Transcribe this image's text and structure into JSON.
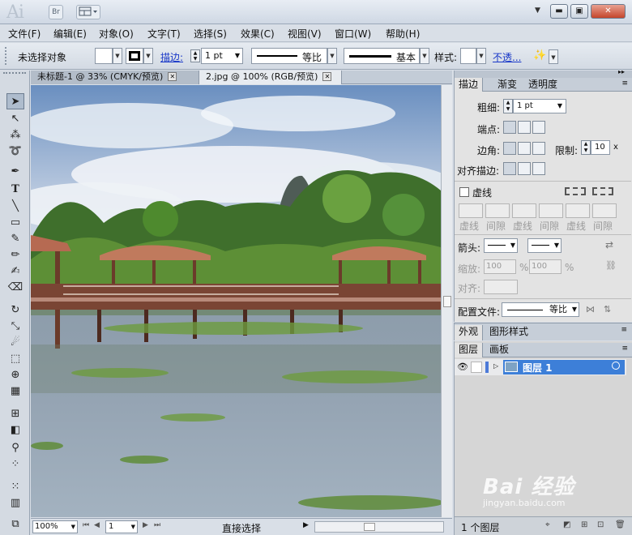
{
  "app": {
    "logo": "Ai",
    "bridge_label": "Br"
  },
  "menu": [
    "文件(F)",
    "编辑(E)",
    "对象(O)",
    "文字(T)",
    "选择(S)",
    "效果(C)",
    "视图(V)",
    "窗口(W)",
    "帮助(H)"
  ],
  "control": {
    "selection_status": "未选择对象",
    "stroke_label": "描边:",
    "stroke_weight": "1 pt",
    "stroke_profile": "等比",
    "brush": "基本",
    "style_label": "样式:",
    "opacity_label": "不透..."
  },
  "documents": [
    {
      "title": "未标题-1 @ 33% (CMYK/预览)",
      "close": "⊠"
    },
    {
      "title": "2.jpg @ 100% (RGB/预览)",
      "close": "⊠"
    }
  ],
  "status": {
    "zoom": "100%",
    "page": "1",
    "tool": "直接选择"
  },
  "stroke_panel": {
    "tabs": [
      "描边",
      "渐变",
      "透明度"
    ],
    "weight_label": "粗细:",
    "weight_value": "1 pt",
    "cap_label": "端点:",
    "corner_label": "边角:",
    "limit_label": "限制:",
    "limit_value": "10",
    "limit_unit": "x",
    "align_label": "对齐描边:",
    "dashed_label": "虚线",
    "dash_labels": [
      "虚线",
      "间隙",
      "虚线",
      "间隙",
      "虚线",
      "间隙"
    ],
    "arrow_label": "箭头:",
    "scale_label": "缩放:",
    "scale_start": "100",
    "scale_end": "100",
    "percent": "%",
    "align_arrow_label": "对齐:",
    "profile_label": "配置文件:",
    "profile_value": "等比"
  },
  "appearance_tabs": [
    "外观",
    "图形样式"
  ],
  "layers_panel": {
    "tabs": [
      "图层",
      "画板"
    ],
    "layer_name": "图层 1",
    "count": "1 个图层"
  },
  "watermark": {
    "text": "Bai 经验",
    "url": "jingyan.baidu.com"
  }
}
